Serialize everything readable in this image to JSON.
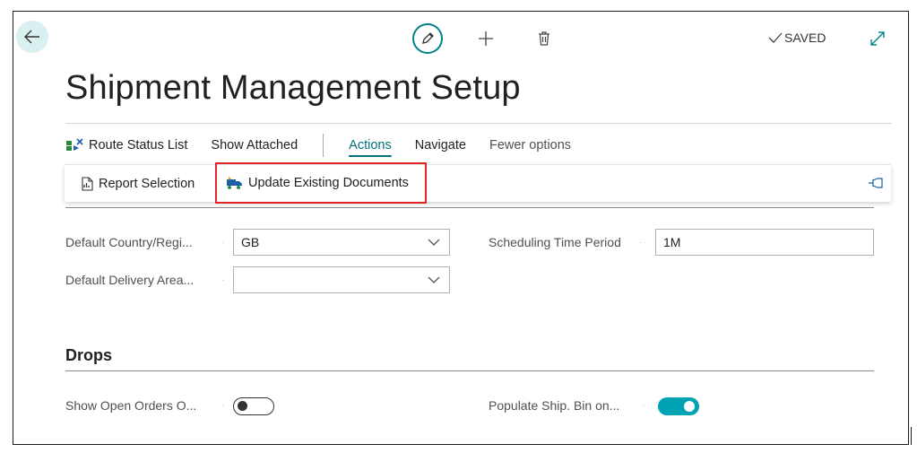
{
  "header": {
    "saved_status": "SAVED",
    "title": "Shipment Management Setup"
  },
  "menu": {
    "route_status_list": "Route Status List",
    "show_attached": "Show Attached",
    "actions": "Actions",
    "navigate": "Navigate",
    "fewer_options": "Fewer options"
  },
  "actions_dropdown": {
    "report_selection": "Report Selection",
    "update_existing_documents": "Update Existing Documents"
  },
  "general": {
    "default_country_label": "Default Country/Regi...",
    "default_country_value": "GB",
    "default_delivery_area_label": "Default Delivery Area...",
    "default_delivery_area_value": "",
    "scheduling_time_period_label": "Scheduling Time Period",
    "scheduling_time_period_value": "1M"
  },
  "drops": {
    "section_title": "Drops",
    "show_open_orders_label": "Show Open Orders O...",
    "show_open_orders_on": false,
    "populate_ship_bin_label": "Populate Ship. Bin on...",
    "populate_ship_bin_on": true
  },
  "colors": {
    "accent": "#00a3b4",
    "highlight_border": "#e0262a",
    "back_button_bg": "#d9eff0"
  }
}
